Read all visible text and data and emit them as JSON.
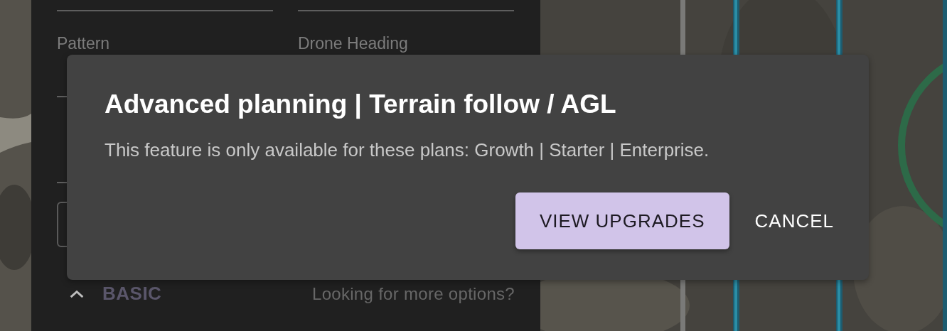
{
  "panel": {
    "fields": [
      {
        "label": "Pattern"
      },
      {
        "label": "Drone Heading"
      }
    ],
    "section": {
      "label": "BASIC",
      "expanded": true,
      "hint": "Looking for more options?"
    }
  },
  "dialog": {
    "title": "Advanced planning | Terrain follow / AGL",
    "message": "This feature is only available for these plans: Growth | Starter | Enterprise.",
    "buttons": [
      {
        "label": "VIEW UPGRADES",
        "kind": "primary"
      },
      {
        "label": "CANCEL",
        "kind": "text"
      }
    ]
  }
}
